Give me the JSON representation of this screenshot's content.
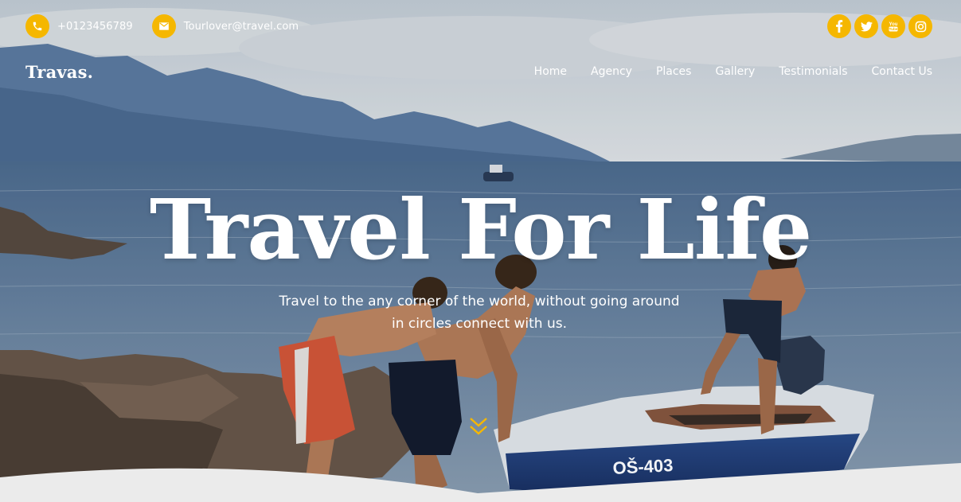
{
  "topbar": {
    "phone": {
      "icon": "phone-icon",
      "text": "+0123456789"
    },
    "email": {
      "icon": "envelope-icon",
      "text": "Tourlover@travel.com"
    },
    "social": [
      {
        "name": "facebook-icon",
        "glyph": "f"
      },
      {
        "name": "twitter-icon",
        "glyph": "t"
      },
      {
        "name": "youtube-icon",
        "glyph": "You Tube"
      },
      {
        "name": "instagram-icon",
        "glyph": ""
      }
    ]
  },
  "nav": {
    "logo": "Travas.",
    "items": [
      "Home",
      "Agency",
      "Places",
      "Gallery",
      "Testimonials",
      "Contact Us"
    ]
  },
  "hero": {
    "title": "Travel For Life",
    "subtitle_line1": "Travel to the any corner of the world, without going around",
    "subtitle_line2": "in circles connect with us.",
    "boat_label": "OŠ-403",
    "scroll_icon": "chevron-down-icon"
  },
  "colors": {
    "accent": "#f5b700",
    "text": "#ffffff"
  }
}
